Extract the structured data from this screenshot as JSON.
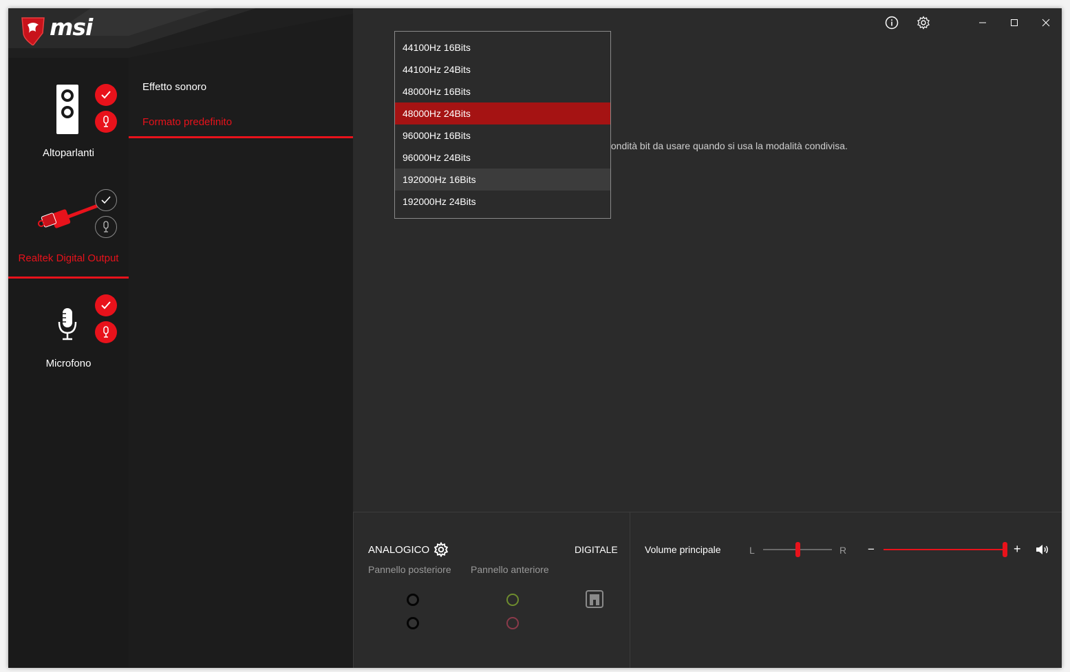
{
  "app": {
    "logo_text": "msi",
    "accent_color": "#e8121b"
  },
  "titlebar": {
    "info_icon": "info-icon",
    "settings_icon": "gear-icon",
    "minimize_icon": "minimize-icon",
    "maximize_icon": "maximize-icon",
    "close_icon": "close-icon"
  },
  "devices": [
    {
      "label": "Altoparlanti",
      "icon": "speaker-icon",
      "default_check": "checked",
      "mic_badge": "active"
    },
    {
      "label": "Realtek Digital Output",
      "icon": "digital-cable-icon",
      "default_check": "unchecked",
      "mic_badge": "inactive",
      "active": true
    },
    {
      "label": "Microfono",
      "icon": "microphone-icon",
      "default_check": "checked",
      "mic_badge": "active"
    }
  ],
  "submenu": {
    "items": [
      {
        "label": "Effetto sonoro"
      },
      {
        "label": "Formato predefinito",
        "active": true
      }
    ]
  },
  "main": {
    "description_visible": "fondità bit da usare quando si usa la modalità condivisa."
  },
  "format_dropdown": {
    "options": [
      "44100Hz 16Bits",
      "44100Hz 24Bits",
      "48000Hz 16Bits",
      "48000Hz 24Bits",
      "96000Hz 16Bits",
      "96000Hz 24Bits",
      "192000Hz 16Bits",
      "192000Hz 24Bits"
    ],
    "selected": "48000Hz 24Bits",
    "hovered": "192000Hz 16Bits"
  },
  "bottom": {
    "analog_label": "ANALOGICO",
    "digital_label": "DIGITALE",
    "rear_panel_label": "Pannello posteriore",
    "front_panel_label": "Pannello anteriore",
    "volume_label": "Volume principale",
    "balance_left": "L",
    "balance_right": "R",
    "volume_minus": "−",
    "volume_plus": "+",
    "balance_value": 0.5,
    "volume_value": 1.0,
    "jack_colors": {
      "rear": "#1a1a1a",
      "front_green": "#6e8c2e",
      "front_pink": "#8a3a4a"
    }
  }
}
